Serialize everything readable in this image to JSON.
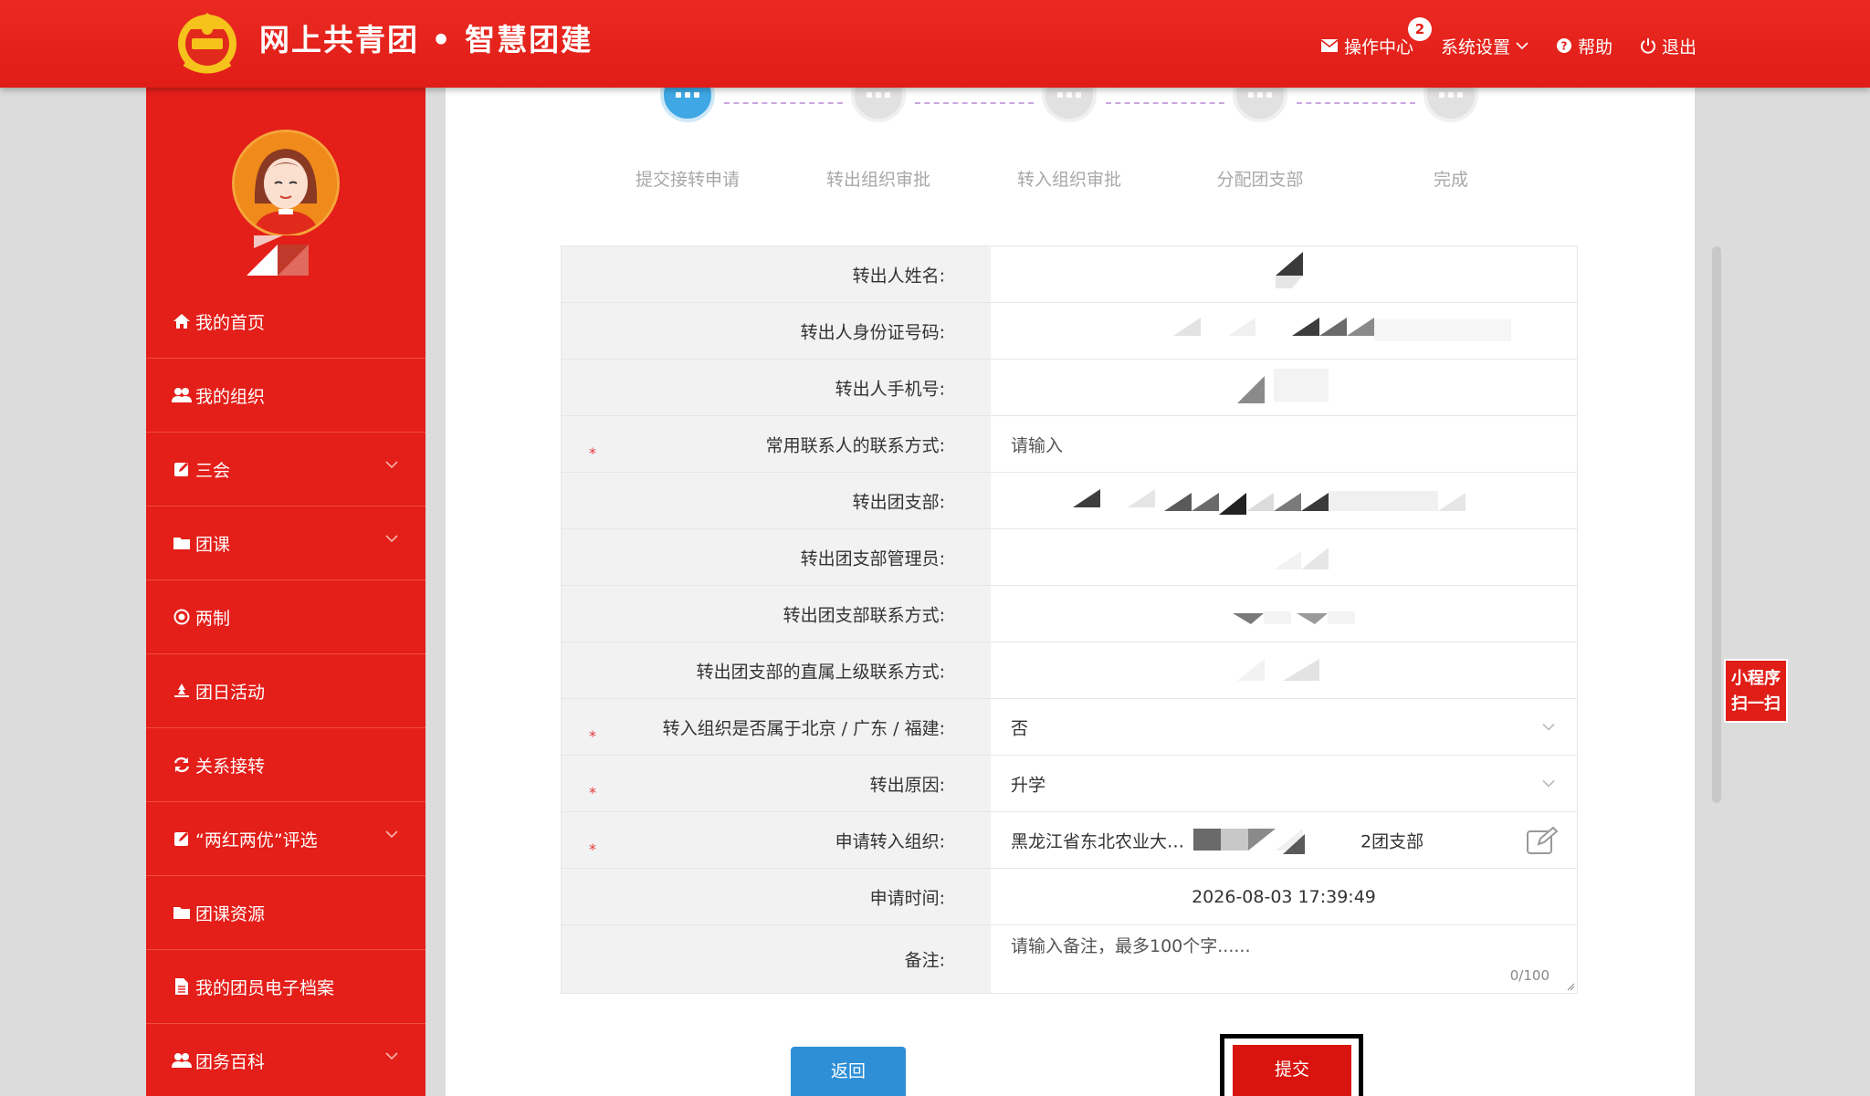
{
  "app": {
    "title": "网上共青团 • 智慧团建"
  },
  "topnav": {
    "ops_center": "操作中心",
    "ops_badge": "2",
    "settings": "系统设置",
    "help": "帮助",
    "logout": "退出"
  },
  "sidebar": {
    "items": [
      {
        "label": "我的首页",
        "icon": "home-icon",
        "expandable": false
      },
      {
        "label": "我的组织",
        "icon": "users-icon",
        "expandable": false
      },
      {
        "label": "三会",
        "icon": "edit-icon",
        "expandable": true
      },
      {
        "label": "团课",
        "icon": "folder-icon",
        "expandable": true
      },
      {
        "label": "两制",
        "icon": "target-icon",
        "expandable": false
      },
      {
        "label": "团日活动",
        "icon": "recycle-icon",
        "expandable": false
      },
      {
        "label": "关系接转",
        "icon": "refresh-icon",
        "expandable": false
      },
      {
        "label": "“两红两优”评选",
        "icon": "edit-icon",
        "expandable": true
      },
      {
        "label": "团课资源",
        "icon": "folder-icon",
        "expandable": false
      },
      {
        "label": "我的团员电子档案",
        "icon": "document-icon",
        "expandable": false
      },
      {
        "label": "团务百科",
        "icon": "users-icon",
        "expandable": true
      }
    ]
  },
  "steps": [
    {
      "label": "提交接转申请",
      "active": true
    },
    {
      "label": "转出组织审批",
      "active": false
    },
    {
      "label": "转入组织审批",
      "active": false
    },
    {
      "label": "分配团支部",
      "active": false
    },
    {
      "label": "完成",
      "active": false
    }
  ],
  "form": {
    "rows": [
      {
        "label": "转出人姓名:",
        "required": false,
        "value": ""
      },
      {
        "label": "转出人身份证号码:",
        "required": false,
        "value": ""
      },
      {
        "label": "转出人手机号:",
        "required": false,
        "value": ""
      },
      {
        "label": "常用联系人的联系方式:",
        "required": true,
        "placeholder": "请输入"
      },
      {
        "label": "转出团支部:",
        "required": false,
        "value": ""
      },
      {
        "label": "转出团支部管理员:",
        "required": false,
        "value": ""
      },
      {
        "label": "转出团支部联系方式:",
        "required": false,
        "value": ""
      },
      {
        "label": "转出团支部的直属上级联系方式:",
        "required": false,
        "value": ""
      },
      {
        "label": "转入组织是否属于北京 / 广东 / 福建:",
        "required": true,
        "value": "否"
      },
      {
        "label": "转出原因:",
        "required": true,
        "value": "升学"
      },
      {
        "label": "申请转入组织:",
        "required": true,
        "value_prefix": "黑龙江省东北农业大…",
        "value_suffix": "2团支部"
      },
      {
        "label": "申请时间:",
        "required": false,
        "value": "2026-08-03 17:39:49"
      },
      {
        "label": "备注:",
        "required": false,
        "placeholder": "请输入备注，最多100个字......",
        "counter": "0/100"
      }
    ],
    "required_mark": "*"
  },
  "buttons": {
    "back": "返回",
    "submit": "提交"
  },
  "mini_program": {
    "line1": "小程序",
    "line2": "扫一扫"
  },
  "colors": {
    "brand_red": "#e01d17",
    "step_active": "#3ea7e4",
    "back_button": "#2e8fd6"
  }
}
